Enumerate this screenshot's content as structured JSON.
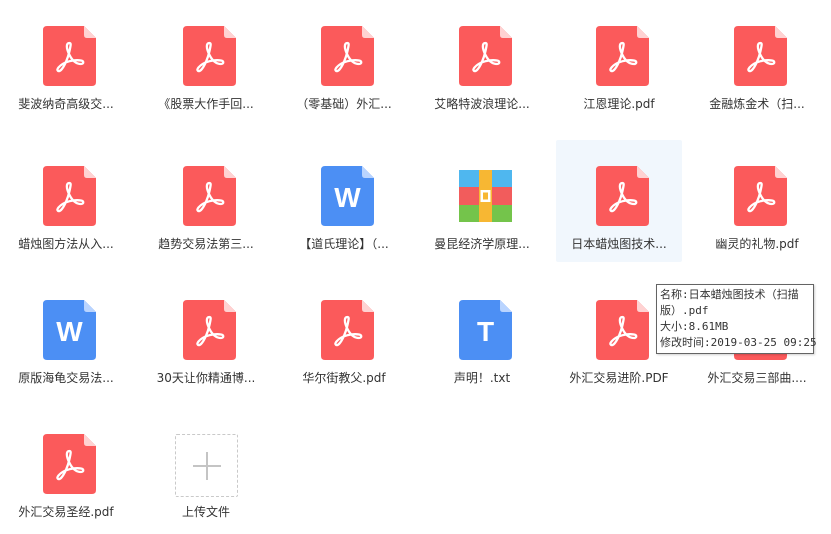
{
  "colors": {
    "pdf": "#fb5a5b",
    "pdf_fold": "#ffd2d2",
    "word": "#4c8ff4",
    "word_fold": "#b9d4ff",
    "txt": "#4c8ff4",
    "txt_fold": "#b9d4ff",
    "selected_bg": "#f1f7fd"
  },
  "files": [
    {
      "label": "斐波纳奇高级交...",
      "icon": "pdf-icon",
      "type": "pdf"
    },
    {
      "label": "《股票大作手回...",
      "icon": "pdf-icon",
      "type": "pdf"
    },
    {
      "label": "（零基础）外汇...",
      "icon": "pdf-icon",
      "type": "pdf"
    },
    {
      "label": "艾略特波浪理论...",
      "icon": "pdf-icon",
      "type": "pdf"
    },
    {
      "label": "江恩理论.pdf",
      "icon": "pdf-icon",
      "type": "pdf"
    },
    {
      "label": "金融炼金术（扫...",
      "icon": "pdf-icon",
      "type": "pdf"
    },
    {
      "label": "蜡烛图方法从入...",
      "icon": "pdf-icon",
      "type": "pdf"
    },
    {
      "label": "趋势交易法第三...",
      "icon": "pdf-icon",
      "type": "pdf"
    },
    {
      "label": "【道氏理论】（...",
      "icon": "word-icon",
      "type": "word",
      "glyph": "W"
    },
    {
      "label": "曼昆经济学原理...",
      "icon": "archive-icon",
      "type": "archive"
    },
    {
      "label": "日本蜡烛图技术...",
      "icon": "pdf-icon",
      "type": "pdf",
      "selected": true
    },
    {
      "label": "幽灵的礼物.pdf",
      "icon": "pdf-icon",
      "type": "pdf"
    },
    {
      "label": "原版海龟交易法...",
      "icon": "word-icon",
      "type": "word",
      "glyph": "W"
    },
    {
      "label": "30天让你精通博...",
      "icon": "pdf-icon",
      "type": "pdf"
    },
    {
      "label": "华尔街教父.pdf",
      "icon": "pdf-icon",
      "type": "pdf"
    },
    {
      "label": "声明！.txt",
      "icon": "txt-icon",
      "type": "txt",
      "glyph": "T"
    },
    {
      "label": "外汇交易进阶.PDF",
      "icon": "pdf-icon",
      "type": "pdf"
    },
    {
      "label": "外汇交易三部曲....",
      "icon": "pdf-icon",
      "type": "pdf"
    },
    {
      "label": "外汇交易圣经.pdf",
      "icon": "pdf-icon",
      "type": "pdf"
    }
  ],
  "upload": {
    "label": "上传文件",
    "icon": "plus-icon"
  },
  "tooltip": {
    "lines": [
      "名称:日本蜡烛图技术（扫描",
      "版）.pdf",
      "大小:8.61MB",
      "修改时间:2019-03-25 09:25"
    ]
  }
}
